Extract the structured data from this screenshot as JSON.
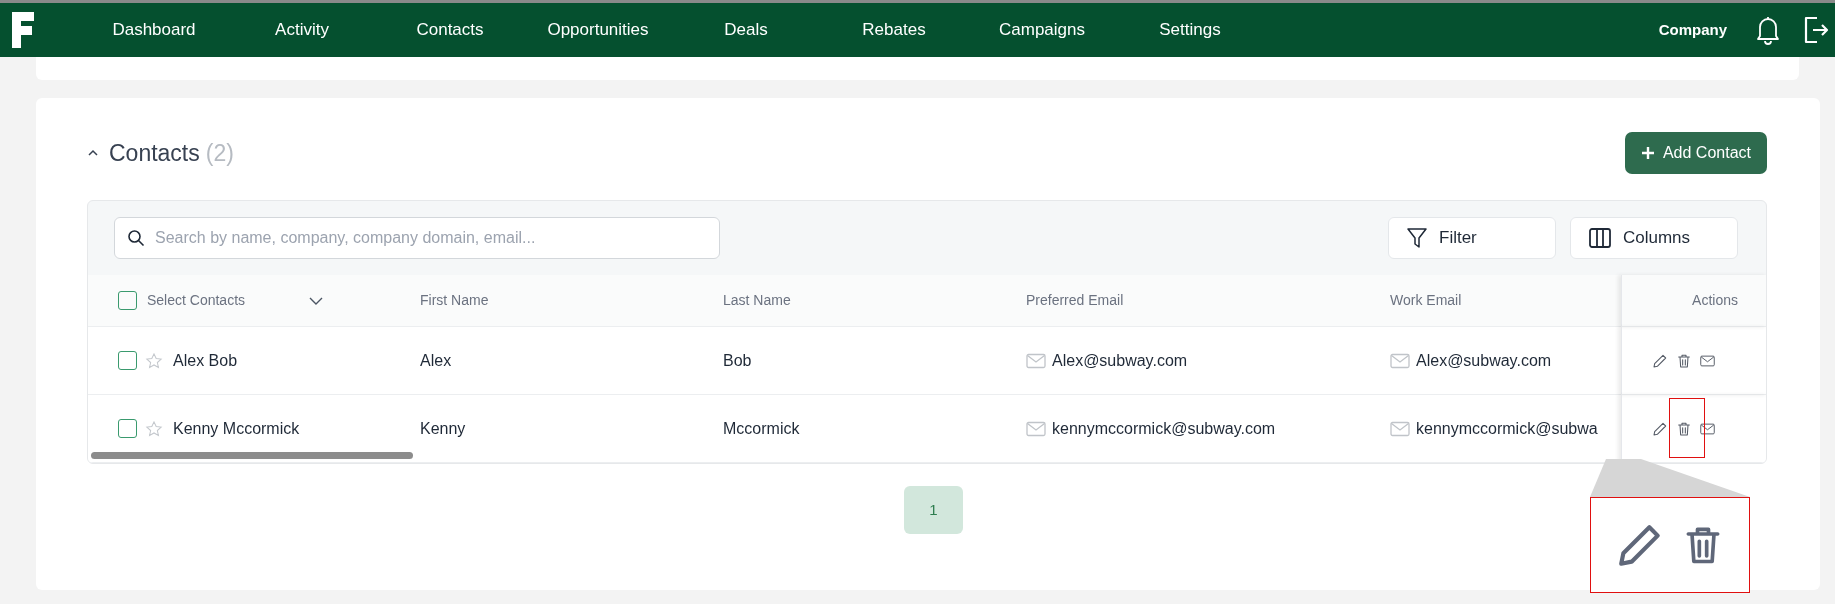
{
  "nav": {
    "items": [
      "Dashboard",
      "Activity",
      "Contacts",
      "Opportunities",
      "Deals",
      "Rebates",
      "Campaigns",
      "Settings"
    ],
    "company": "Company"
  },
  "section": {
    "title": "Contacts",
    "count": "(2)",
    "expanded": true,
    "add_button": "Add Contact"
  },
  "toolbar": {
    "search": {
      "placeholder": "Search by name, company, company domain, email..."
    },
    "buttons": [
      {
        "kind": "filter",
        "label": "Filter"
      },
      {
        "kind": "columns",
        "label": "Columns"
      }
    ]
  },
  "table": {
    "select_all": {
      "label": "Select Contacts",
      "checked": false
    },
    "columns": [
      "First Name",
      "Last Name",
      "Preferred Email",
      "Work Email",
      "Actions"
    ],
    "rows": [
      {
        "checked": false,
        "starred": false,
        "name": "Alex Bob",
        "first_name": "Alex",
        "last_name": "Bob",
        "preferred_email": "Alex@subway.com",
        "work_email": "Alex@subway.com"
      },
      {
        "checked": false,
        "starred": false,
        "name": "Kenny Mccormick",
        "first_name": "Kenny",
        "last_name": "Mccormick",
        "preferred_email": "kennymccormick@subway.com",
        "work_email": "kennymccormick@subwa"
      }
    ]
  },
  "pagination": [
    {
      "label": "1",
      "selected": true
    }
  ]
}
